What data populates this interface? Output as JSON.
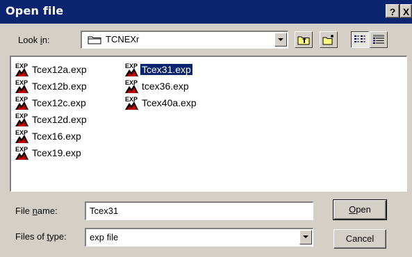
{
  "window": {
    "title": "Open file"
  },
  "titlebar_buttons": {
    "help": "?",
    "close": "X"
  },
  "look_in": {
    "label": "Look in:",
    "value": "TCNEXr"
  },
  "toolbar": {
    "icons": [
      "up-one-level-icon",
      "create-new-folder-icon",
      "list-view-icon",
      "details-view-icon"
    ]
  },
  "files": [
    {
      "name": "Tcex12a.exp"
    },
    {
      "name": "Tcex12b.exp"
    },
    {
      "name": "Tcex12c.exp"
    },
    {
      "name": "Tcex12d.exp"
    },
    {
      "name": "Tcex16.exp"
    },
    {
      "name": "Tcex19.exp"
    },
    {
      "name": "Tcex31.exp",
      "selected": true
    },
    {
      "name": "tcex36.exp"
    },
    {
      "name": "Tcex40a.exp"
    }
  ],
  "file_name": {
    "label": "File name:",
    "value": "Tcex31"
  },
  "file_type": {
    "label": "Files of type:",
    "value": "exp file"
  },
  "buttons": {
    "open": "Open",
    "cancel": "Cancel"
  },
  "colors": {
    "titlebar": "#0a2470",
    "face": "#d4d0c8",
    "selection": "#0a2470"
  }
}
